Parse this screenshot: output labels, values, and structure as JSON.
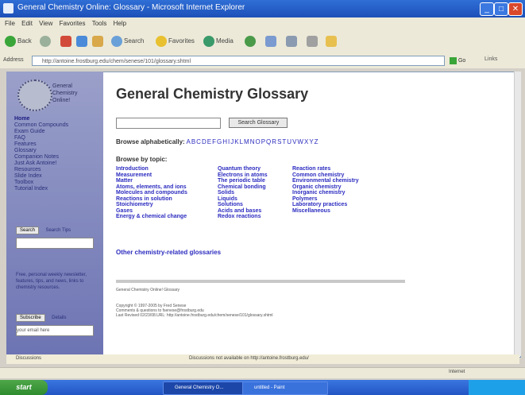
{
  "window": {
    "title": "General Chemistry Online: Glossary - Microsoft Internet Explorer"
  },
  "menu": [
    "File",
    "Edit",
    "View",
    "Favorites",
    "Tools",
    "Help"
  ],
  "toolbar": {
    "back": "Back",
    "search": "Search",
    "favorites": "Favorites",
    "media": "Media"
  },
  "address": {
    "label": "Address",
    "url": "http://antoine.frostburg.edu/chem/senese/101/glossary.shtml",
    "go": "Go",
    "links": "Links"
  },
  "sidebar": {
    "logo_text": [
      "General",
      "Chemistry",
      "Online!"
    ],
    "nav": [
      "Home",
      "Common Compounds",
      "Exam Guide",
      "FAQ",
      "Features",
      "Glossary",
      "Companion Notes",
      "Just Ask Antoine!",
      "Resources",
      "Slide Index",
      "Toolbox",
      "Tutorial Index"
    ],
    "search_btn": "Search",
    "search_link": "Search Tips",
    "note": "Free, personal weekly newsletter, features, tips, and news, links to chemistry resources.",
    "subscribe_btn": "Subscribe",
    "subscribe_link": "Details",
    "email_placeholder": "your email here"
  },
  "main": {
    "title": "General Chemistry Glossary",
    "search_button": "Search Glossary",
    "browse_alpha_label": "Browse alphabetically:",
    "letters": [
      "A",
      "B",
      "C",
      "D",
      "E",
      "F",
      "G",
      "H",
      "I",
      "J",
      "K",
      "L",
      "M",
      "N",
      "O",
      "P",
      "Q",
      "R",
      "S",
      "T",
      "U",
      "V",
      "W",
      "X",
      "Y",
      "Z"
    ],
    "browse_topic_label": "Browse by topic:",
    "topics_col1": [
      "Introduction",
      "Measurement",
      "Matter",
      "Atoms, elements, and ions",
      "Molecules and compounds",
      "Reactions in solution",
      "Stoichiometry",
      "Gases",
      "Energy & chemical change"
    ],
    "topics_col2": [
      "Quantum theory",
      "Electrons in atoms",
      "The periodic table",
      "Chemical bonding",
      "Solids",
      "Liquids",
      "Solutions",
      "Acids and bases",
      "Redox reactions"
    ],
    "topics_col3": [
      "Reaction rates",
      "Common chemistry",
      "Environmental chemistry",
      "Organic chemistry",
      "Inorganic chemistry",
      "Polymers",
      "Laboratory practices",
      "Miscellaneous"
    ],
    "other_link": "Other chemistry-related glossaries",
    "footnote": "General Chemistry Online! Glossary",
    "copyright_1": "Copyright © 1997-2005 by Fred Senese",
    "copyright_2": "Comments & questions to fsenese@frostburg.edu",
    "copyright_3": "Last Revised 02/23/08.URL: http://antoine.frostburg.edu/chem/senese/101/glossary.shtml"
  },
  "ie_bar": {
    "left": "Discussions",
    "message": "Discussions not available on http://antoine.frostburg.edu/"
  },
  "statusbar": {
    "zone": "Internet"
  },
  "taskbar": {
    "start": "start",
    "task1": "General Chemistry O...",
    "task2": "untitled - Paint"
  },
  "colors": {
    "link": "#2c2cc0",
    "sidebar": "#7d83bd"
  }
}
